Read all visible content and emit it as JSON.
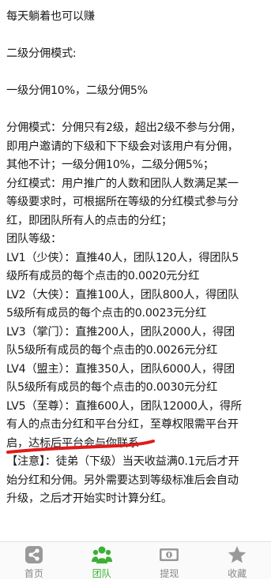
{
  "article": {
    "lines": [
      "每天躺着也可以赚",
      "",
      "二级分佣模式:",
      "",
      "一级分佣10%，二级分佣5%",
      "",
      "分佣模式：分佣只有2级，超出2级不参与分佣，",
      "即用户邀请的下级和下下级会对该用户有分佣，",
      "其他不计；一级分佣10%，二级分佣5%；",
      "分红模式：用户推广的人数和团队人数满足某一",
      "等级要求时，可根据所在等级的分红模式参与分",
      "红，即团队所有人的点击的分红；",
      "团队等级：",
      "LV1（少侠）：直推40人，团队120人，得团队5",
      "级所有成员的每个点击的0.0020元分红",
      "LV2（大侠）：直推100人，团队800人，得团队",
      "5级所有成员的每个点击的0.0023元分红",
      "LV3（掌门）：直推200人，团队2000人，得团",
      "队5级所有成员的每个点击的0.0026元分红",
      "LV4（盟主）：直推350人，团队6000人，得团",
      "队5级所有成员的每个点击的0.0030元分红",
      "LV5（至尊）：直推600人，团队12000人，得所",
      "有人的点击分红和平台分红，至尊权限需平台开",
      "启，达标后平台会与你联系",
      "【注意】：徒弟（下级）当天收益满0.1元后才开",
      "始分红和分佣。另外需要达到等级标准后会自动",
      "升级，之后才开始实时计算分红。"
    ]
  },
  "tabbar": {
    "items": [
      {
        "label": "首页",
        "icon": "share-icon",
        "active": false
      },
      {
        "label": "团队",
        "icon": "team-icon",
        "active": true
      },
      {
        "label": "提现",
        "icon": "cash-icon",
        "active": false
      },
      {
        "label": "收藏",
        "icon": "star-icon",
        "active": false
      }
    ]
  },
  "colors": {
    "text": "#1a1a1a",
    "tab_inactive": "#888888",
    "tab_active": "#3cb034",
    "annotation": "#e01b1b"
  }
}
